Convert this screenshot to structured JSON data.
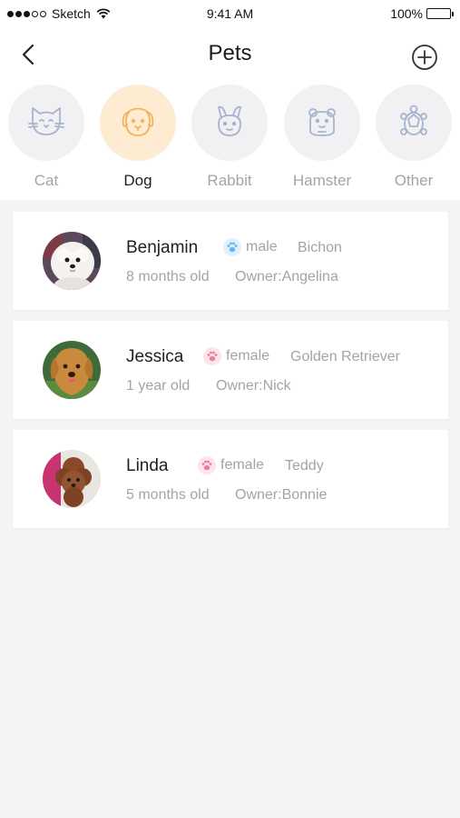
{
  "status_bar": {
    "carrier": "Sketch",
    "time": "9:41 AM",
    "battery": "100%"
  },
  "nav": {
    "title": "Pets"
  },
  "categories": [
    {
      "label": "Cat",
      "icon": "cat-icon",
      "active": false
    },
    {
      "label": "Dog",
      "icon": "dog-icon",
      "active": true
    },
    {
      "label": "Rabbit",
      "icon": "rabbit-icon",
      "active": false
    },
    {
      "label": "Hamster",
      "icon": "hamster-icon",
      "active": false
    },
    {
      "label": "Other",
      "icon": "turtle-icon",
      "active": false
    }
  ],
  "pets": [
    {
      "name": "Benjamin",
      "gender": "male",
      "breed": "Bichon",
      "age": "8 months old",
      "owner": "Owner:Angelina"
    },
    {
      "name": "Jessica",
      "gender": "female",
      "breed": "Golden Retriever",
      "age": "1 year old",
      "owner": "Owner:Nick"
    },
    {
      "name": "Linda",
      "gender": "female",
      "breed": "Teddy",
      "age": "5 months old",
      "owner": "Owner:Bonnie"
    }
  ],
  "colors": {
    "male": "#5bb8e8",
    "female": "#f07a9a",
    "active_category_bg": "#fdebd2",
    "active_category_icon": "#f4b35c",
    "inactive_icon": "#a9b2cf"
  }
}
